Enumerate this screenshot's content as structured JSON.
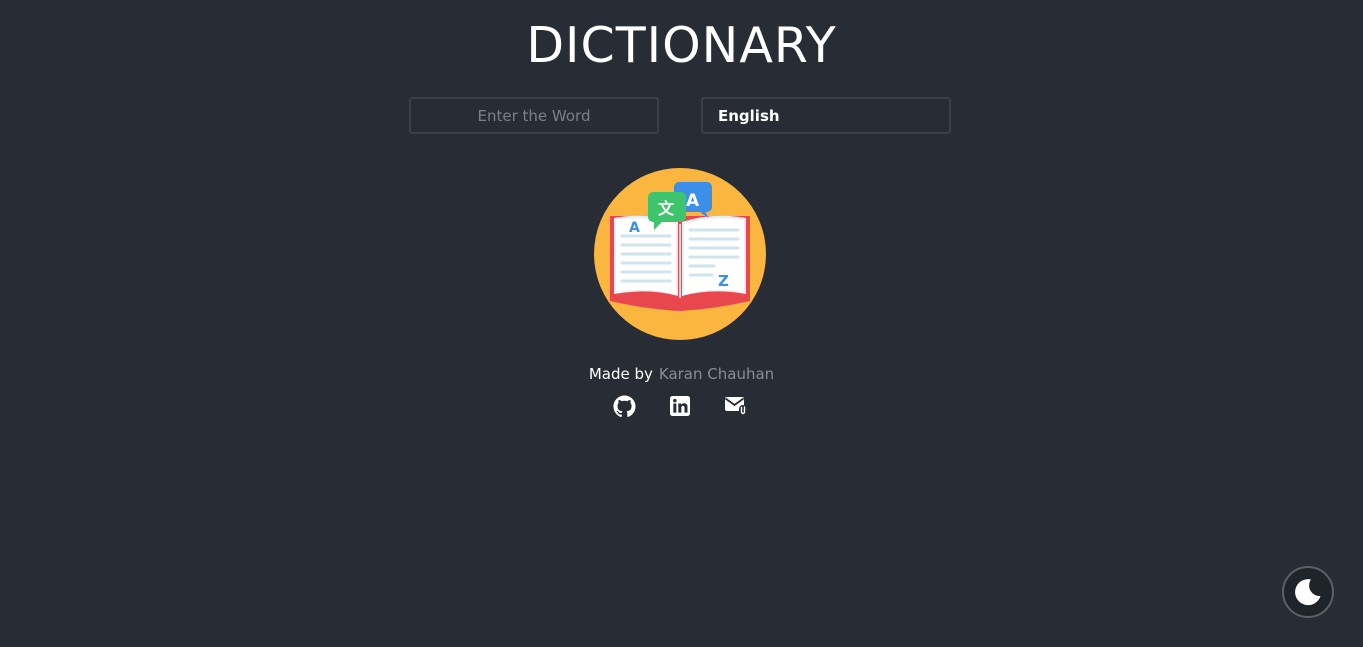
{
  "header": {
    "title": "DICTIONARY"
  },
  "search": {
    "placeholder": "Enter the Word",
    "value": ""
  },
  "language": {
    "selected": "English"
  },
  "hero": {
    "icon": "open-book-translate-icon",
    "letters": {
      "left_top": "A",
      "right_bottom": "Z",
      "bubble_cn": "文",
      "bubble_en": "A"
    }
  },
  "footer": {
    "made_by_label": "Made by",
    "author": "Karan Chauhan",
    "socials": [
      {
        "name": "github-icon"
      },
      {
        "name": "linkedin-icon"
      },
      {
        "name": "mail-icon"
      }
    ]
  },
  "theme_toggle": {
    "icon": "moon-icon"
  },
  "colors": {
    "background": "#282c35",
    "text": "#ffffff",
    "muted": "#8a8d94",
    "book_circle": "#fbb63f",
    "book_cover": "#e8484d",
    "bubble_green": "#3ec46d",
    "bubble_blue": "#3b8fe8"
  }
}
